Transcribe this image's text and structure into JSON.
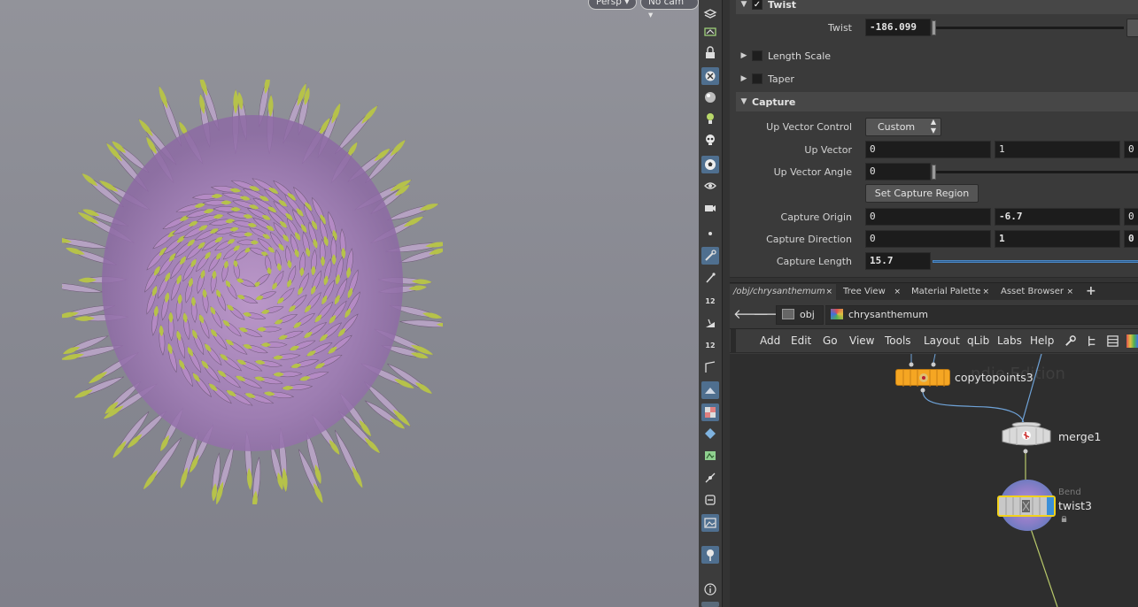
{
  "viewport": {
    "camera_menu": "Persp",
    "cam_menu": "No cam"
  },
  "params": {
    "twist_section": {
      "label": "Twist",
      "checked": true
    },
    "twist_param": {
      "label": "Twist",
      "value": "-186.099"
    },
    "length_scale": {
      "label": "Length Scale"
    },
    "taper": {
      "label": "Taper"
    },
    "capture_section": {
      "label": "Capture"
    },
    "up_vector_control": {
      "label": "Up Vector Control",
      "value": "Custom"
    },
    "up_vector": {
      "label": "Up Vector",
      "x": "0",
      "y": "1",
      "z": "0"
    },
    "up_vector_angle": {
      "label": "Up Vector Angle",
      "value": "0"
    },
    "set_capture_region": "Set Capture Region",
    "capture_origin": {
      "label": "Capture Origin",
      "x": "0",
      "y": "-6.7",
      "z": "0"
    },
    "capture_direction": {
      "label": "Capture Direction",
      "x": "0",
      "y": "1",
      "z": "0"
    },
    "capture_length": {
      "label": "Capture Length",
      "value": "15.7"
    }
  },
  "tabs": [
    {
      "label": "/obj/chrysanthemum"
    },
    {
      "label": "Tree View"
    },
    {
      "label": "Material Palette"
    },
    {
      "label": "Asset Browser"
    }
  ],
  "tab_close": "×",
  "tab_add": "+",
  "path": {
    "root": "obj",
    "node": "chrysanthemum"
  },
  "menu": [
    "Add",
    "Edit",
    "Go",
    "View",
    "Tools",
    "Layout",
    "qLib",
    "Labs",
    "Help"
  ],
  "network": {
    "watermark": "ndie Edition",
    "nodes": {
      "copytopoints": "copytopoints3",
      "merge": "merge1",
      "twist": "twist3",
      "twist_subtitle": "Bend"
    }
  },
  "shelf_numbers": [
    "12",
    "12"
  ],
  "colors": {
    "viewport_bg": "#8a8b93",
    "petal_green": "#b6c24a",
    "petal_purple": "#b48ac4",
    "copy_node": "#f5a623",
    "selected_outline": "#f2d21b",
    "display_flag": "#3a8fd8"
  }
}
